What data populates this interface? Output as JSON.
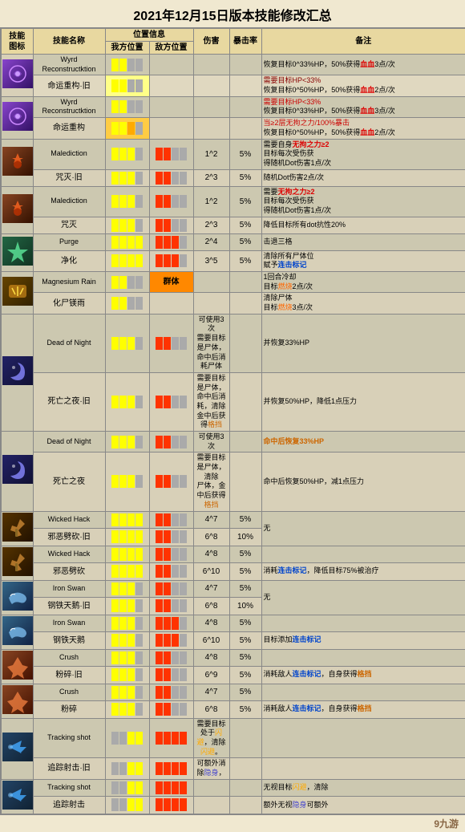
{
  "title": "2021年12月15日版本技能修改汇总",
  "headers": {
    "icon": "技能\n图标",
    "name": "技能名称",
    "position": "位置信息",
    "my_pos": "我方位置",
    "enemy_pos": "敌方位置",
    "damage": "伤害",
    "crit": "暴击率",
    "note": "备注"
  },
  "rows": [
    {
      "icon_class": "icon-bg-1",
      "name_en": "Wyrd Reconstructktion",
      "name_cn": "命运重构·旧",
      "name_new_en": "Wyrd Reconstructktion",
      "name_new_cn": "命运重构",
      "my_pos": [
        1,
        1,
        0,
        0
      ],
      "enemy_pos": [
        0,
        0,
        0,
        0
      ],
      "my_pos_new": [
        1,
        1,
        0,
        0
      ],
      "enemy_pos_new": [
        0,
        0,
        0,
        0
      ],
      "condition_old": "需要目标HP<33%",
      "condition_new_1": "",
      "condition_new_2": "当≥2层无拘之力/100%暴击",
      "damage_old": "",
      "damage_new": "",
      "crit_old": "",
      "crit_new": "",
      "note_old": "恢复目标0^33%HP，50%获得血血3点/次",
      "note_new": "恢复目标0^50%HP，50%获得血血2点/次"
    }
  ],
  "table_rows": [
    {
      "id": 1,
      "type": "en",
      "icon": "1",
      "name": "Wyrd Reconstructktion",
      "my": [
        1,
        2,
        0,
        0
      ],
      "enemy": [
        0,
        0,
        0,
        0
      ],
      "condition": "",
      "damage": "",
      "crit": "",
      "note": "恢复目标0^33%HP，50%获得血血3点/次",
      "note_color": "normal"
    },
    {
      "id": 2,
      "type": "cn-old",
      "icon": "1",
      "name": "命运重构·旧",
      "my": [
        1,
        2,
        0,
        0
      ],
      "enemy": [
        0,
        0,
        0,
        0
      ],
      "condition": "需要目标HP<33%",
      "damage": "",
      "crit": "",
      "note": "恢复目标0^50%HP，50%获得血血2点/次",
      "note_color": "normal"
    },
    {
      "id": 3,
      "type": "en",
      "icon": "1",
      "name": "Wyrd Reconstructktion",
      "my": [
        1,
        2,
        0,
        0
      ],
      "enemy": [
        0,
        0,
        0,
        0
      ],
      "condition": "需要目标HP<33%",
      "damage": "",
      "crit": "",
      "note": "恢复目标0^33%HP，50%获得血血3点/次",
      "note_color": "red"
    },
    {
      "id": 4,
      "type": "cn-new",
      "icon": "1",
      "name": "命运重构",
      "my": [
        1,
        2,
        3,
        0
      ],
      "enemy": [
        0,
        0,
        0,
        0
      ],
      "condition": "当≥2层无拘之力/100%暴击",
      "damage": "",
      "crit": "",
      "note": "恢复目标0^50%HP，50%获得血血2点/次",
      "note_color": "red"
    }
  ],
  "skills": [
    {
      "group": 1,
      "rows": [
        {
          "en": "Wyrd Reconstructktion",
          "cn": "命运重构·旧",
          "is_old": true,
          "my": "y2",
          "enemy": "",
          "condition": "需要目标HP<33%",
          "dmg": "",
          "crit": "",
          "note": "恢复目标0^33%HP，50%获得<r>血血</r>3点/次"
        },
        {
          "en": null,
          "cn": "命运重构",
          "is_old": false,
          "my": "y3",
          "enemy": "",
          "condition": "当≥2层无拘之力/100%暴击",
          "dmg": "",
          "crit": "",
          "note": "恢复目标0^50%HP，50%获得<r>血血</r>2点/次"
        }
      ]
    }
  ],
  "footer": "9九游"
}
